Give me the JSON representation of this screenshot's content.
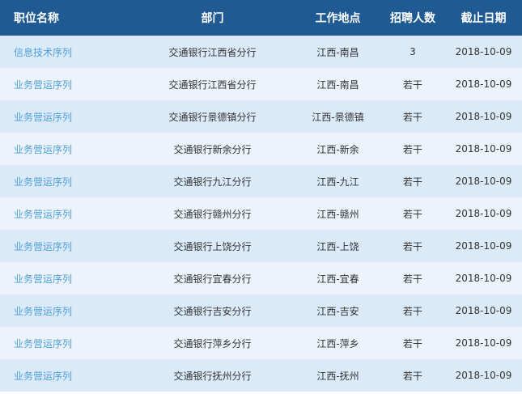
{
  "table": {
    "headers": {
      "position": "职位名称",
      "department": "部门",
      "location": "工作地点",
      "count": "招聘人数",
      "deadline": "截止日期"
    },
    "rows": [
      {
        "position": "信息技术序列",
        "department": "交通银行江西省分行",
        "location": "江西-南昌",
        "count": "3",
        "deadline": "2018-10-09"
      },
      {
        "position": "业务营运序列",
        "department": "交通银行江西省分行",
        "location": "江西-南昌",
        "count": "若干",
        "deadline": "2018-10-09"
      },
      {
        "position": "业务营运序列",
        "department": "交通银行景德镇分行",
        "location": "江西-景德镇",
        "count": "若干",
        "deadline": "2018-10-09"
      },
      {
        "position": "业务营运序列",
        "department": "交通银行新余分行",
        "location": "江西-新余",
        "count": "若干",
        "deadline": "2018-10-09"
      },
      {
        "position": "业务营运序列",
        "department": "交通银行九江分行",
        "location": "江西-九江",
        "count": "若干",
        "deadline": "2018-10-09"
      },
      {
        "position": "业务营运序列",
        "department": "交通银行赣州分行",
        "location": "江西-赣州",
        "count": "若干",
        "deadline": "2018-10-09"
      },
      {
        "position": "业务营运序列",
        "department": "交通银行上饶分行",
        "location": "江西-上饶",
        "count": "若干",
        "deadline": "2018-10-09"
      },
      {
        "position": "业务营运序列",
        "department": "交通银行宜春分行",
        "location": "江西-宜春",
        "count": "若干",
        "deadline": "2018-10-09"
      },
      {
        "position": "业务营运序列",
        "department": "交通银行吉安分行",
        "location": "江西-吉安",
        "count": "若干",
        "deadline": "2018-10-09"
      },
      {
        "position": "业务营运序列",
        "department": "交通银行萍乡分行",
        "location": "江西-萍乡",
        "count": "若干",
        "deadline": "2018-10-09"
      },
      {
        "position": "业务营运序列",
        "department": "交通银行抚州分行",
        "location": "江西-抚州",
        "count": "若干",
        "deadline": "2018-10-09"
      }
    ]
  },
  "colors": {
    "header_bg": "#1f5a93",
    "header_text": "#ffffff",
    "row_odd": "#dbeaf8",
    "row_even": "#ecf3fb",
    "link": "#4f9fd8",
    "text": "#333333"
  }
}
